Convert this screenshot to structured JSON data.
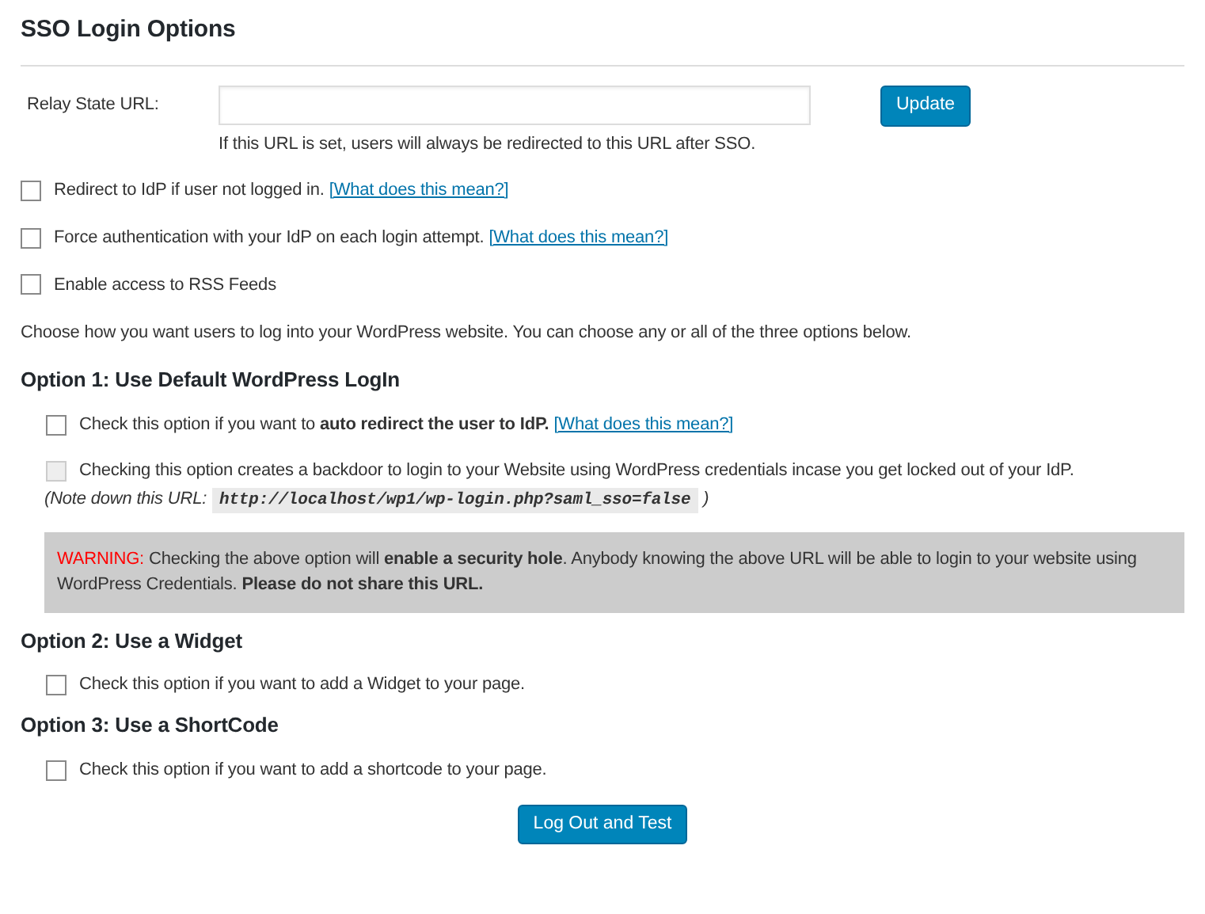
{
  "title": "SSO Login Options",
  "relay_state": {
    "label": "Relay State URL:",
    "hint": "If this URL is set, users will always be redirected to this URL after SSO."
  },
  "update_button": "Update",
  "top_options": [
    {
      "label": "Redirect to IdP if user not logged in.",
      "link": "[What does this mean?]",
      "checked": false,
      "disabled": false
    },
    {
      "label": "Force authentication with your IdP on each login attempt.",
      "link": "[What does this mean?]",
      "checked": false,
      "disabled": false
    },
    {
      "label": "Enable access to RSS Feeds",
      "checked": false,
      "disabled": false
    }
  ],
  "intro": "Choose how you want users to log into your WordPress website. You can choose any or all of the three options below.",
  "sections": [
    {
      "heading": "Option 1: Use Default WordPress LogIn",
      "options": [
        {
          "label": "Check this option if you want to **auto redirect the user to IdP.**",
          "link": "[What does this mean?]",
          "checked": false,
          "disabled": false
        },
        {
          "label": "Checking this option creates a backdoor to login to your Website using WordPress credentials incase you get locked out of your IdP.",
          "checked": false,
          "disabled": true
        }
      ],
      "note": {
        "prefix": "(Note down this URL:",
        "url": "http://localhost/wp1/wp-login.php?saml_sso=false",
        "suffix": ")"
      },
      "warning": {
        "label": "WARNING:",
        "text": "Checking the above option will **enable a security hole**. Anybody knowing the above URL will be able to login to your website using WordPress Credentials. **Please do not share this URL.**"
      }
    },
    {
      "heading": "Option 2: Use a Widget",
      "options": [
        {
          "label": "Check this option if you want to add a Widget to your page.",
          "checked": false,
          "disabled": false
        }
      ]
    },
    {
      "heading": "Option 3: Use a ShortCode",
      "options": [
        {
          "label": "Check this option if you want to add a shortcode to your page.",
          "checked": false,
          "disabled": false
        }
      ]
    }
  ],
  "test_button": "Log Out and Test"
}
